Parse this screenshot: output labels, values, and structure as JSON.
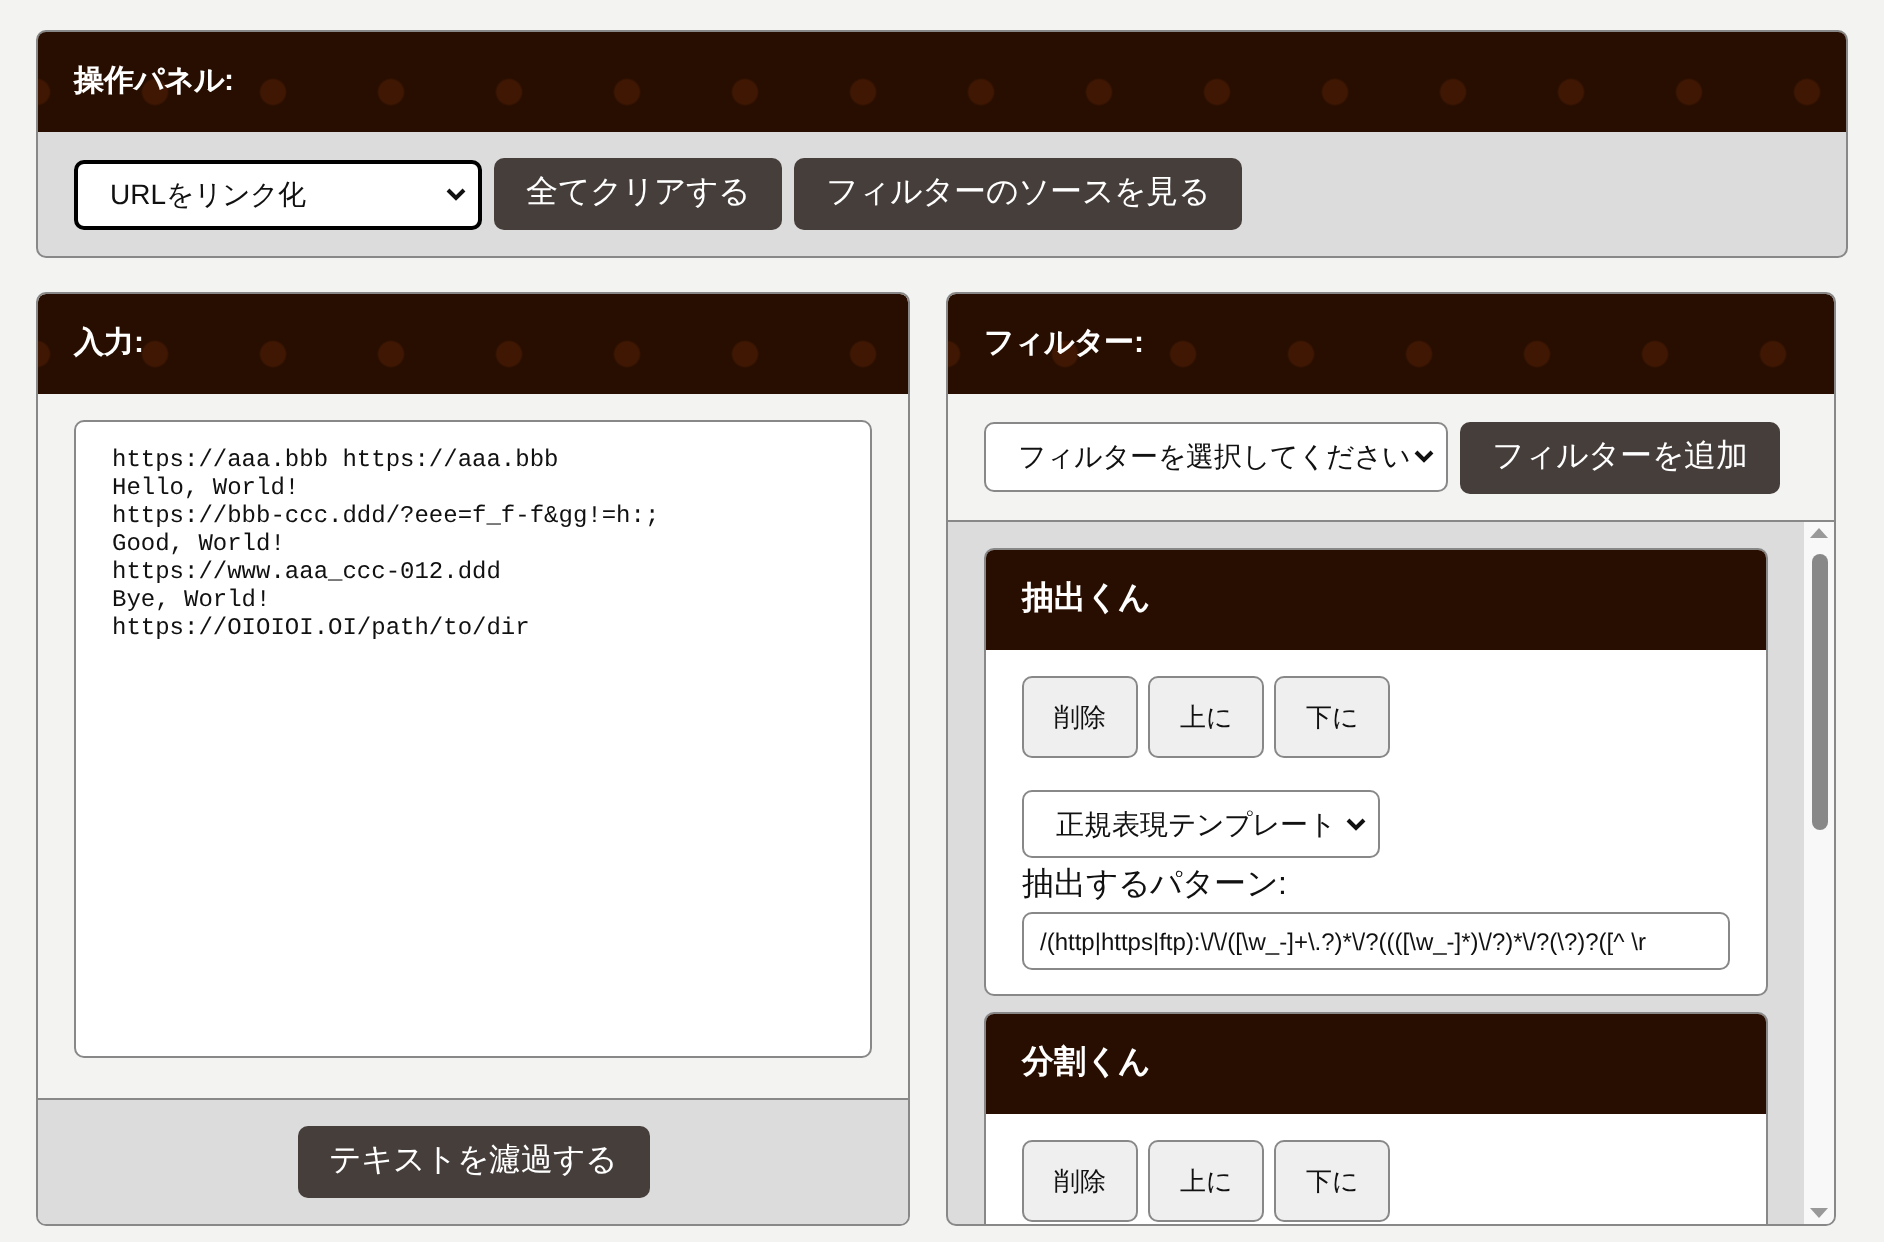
{
  "control_panel": {
    "title": "操作パネル:",
    "preset_select": {
      "value": "URLをリンク化"
    },
    "buttons": [
      "全てクリアする",
      "フィルターのソースを見る"
    ]
  },
  "input_panel": {
    "title": "入力:",
    "text": "https://aaa.bbb https://aaa.bbb\nHello, World!\nhttps://bbb-ccc.ddd/?eee=f_f-f&gg!=h:;\nGood, World!\nhttps://www.aaa_ccc-012.ddd\nBye, World!\nhttps://OIOIOI.OI/path/to/dir",
    "button": "テキストを濾過する"
  },
  "filter_panel": {
    "title": "フィルター:",
    "filter_select": {
      "value": "フィルターを選択してください"
    },
    "add_button": "フィルターを追加",
    "filters": [
      {
        "kind": "extract",
        "title": "抽出くん",
        "buttons": [
          "削除",
          "上に",
          "下に"
        ],
        "template_select": "正規表現テンプレート",
        "pattern_label": "抽出するパターン:",
        "pattern": "/(http|https|ftp):\\/\\/([\\w_-]+\\.?)*\\/?((([\\w_-]*)\\/?)*\\/?(\\?)?([^ \\r"
      },
      {
        "kind": "split",
        "title": "分割くん",
        "buttons": [
          "削除",
          "上に",
          "下に"
        ]
      }
    ]
  }
}
